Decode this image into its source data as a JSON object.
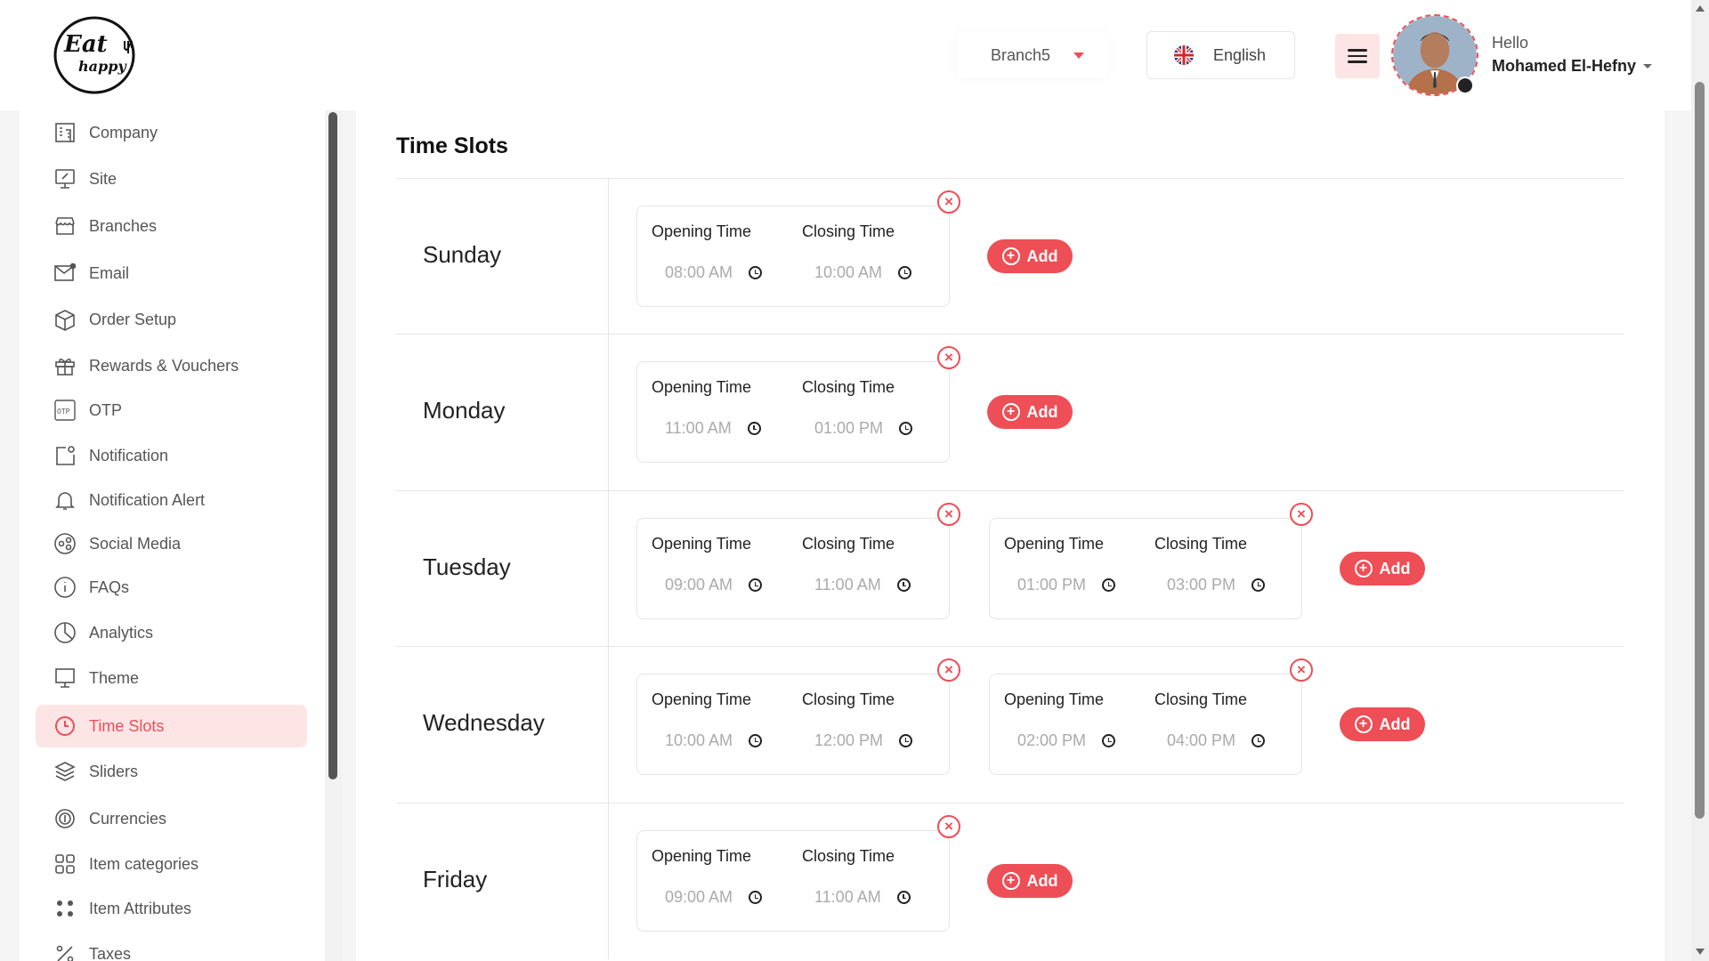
{
  "header": {
    "logo_text_top": "Eat",
    "logo_text_bottom": "happy",
    "branch": "Branch5",
    "language": "English",
    "greeting": "Hello",
    "user_name": "Mohamed El-Hefny"
  },
  "sidebar": {
    "items": [
      {
        "label": "Company",
        "icon": "building-icon"
      },
      {
        "label": "Site",
        "icon": "site-icon"
      },
      {
        "label": "Branches",
        "icon": "store-icon"
      },
      {
        "label": "Email",
        "icon": "email-icon"
      },
      {
        "label": "Order Setup",
        "icon": "box-icon"
      },
      {
        "label": "Rewards & Vouchers",
        "icon": "gift-icon"
      },
      {
        "label": "OTP",
        "icon": "otp-icon"
      },
      {
        "label": "Notification",
        "icon": "notification-icon"
      },
      {
        "label": "Notification Alert",
        "icon": "bell-icon"
      },
      {
        "label": "Social Media",
        "icon": "share-icon"
      },
      {
        "label": "FAQs",
        "icon": "info-icon"
      },
      {
        "label": "Analytics",
        "icon": "pie-chart-icon"
      },
      {
        "label": "Theme",
        "icon": "monitor-icon"
      },
      {
        "label": "Time Slots",
        "icon": "clock-icon"
      },
      {
        "label": "Sliders",
        "icon": "layers-icon"
      },
      {
        "label": "Currencies",
        "icon": "currency-icon"
      },
      {
        "label": "Item categories",
        "icon": "grid-icon"
      },
      {
        "label": "Item Attributes",
        "icon": "dots-icon"
      },
      {
        "label": "Taxes",
        "icon": "percent-icon"
      }
    ],
    "active": "Time Slots"
  },
  "main": {
    "title": "Time Slots",
    "opening_label": "Opening Time",
    "closing_label": "Closing Time",
    "add_label": "Add",
    "remove_glyph": "×",
    "plus_glyph": "+",
    "days": [
      {
        "name": "Sunday",
        "slots": [
          {
            "open": "08:00 AM",
            "close": "10:00 AM"
          }
        ]
      },
      {
        "name": "Monday",
        "slots": [
          {
            "open": "11:00 AM",
            "close": "01:00 PM"
          }
        ]
      },
      {
        "name": "Tuesday",
        "slots": [
          {
            "open": "09:00 AM",
            "close": "11:00 AM"
          },
          {
            "open": "01:00 PM",
            "close": "03:00 PM"
          }
        ]
      },
      {
        "name": "Wednesday",
        "slots": [
          {
            "open": "10:00 AM",
            "close": "12:00 PM"
          },
          {
            "open": "02:00 PM",
            "close": "04:00 PM"
          }
        ]
      },
      {
        "name": "Friday",
        "slots": [
          {
            "open": "09:00 AM",
            "close": "11:00 AM"
          }
        ]
      }
    ]
  },
  "colors": {
    "accent": "#ee4e55",
    "accent_light": "#fde5e6"
  }
}
